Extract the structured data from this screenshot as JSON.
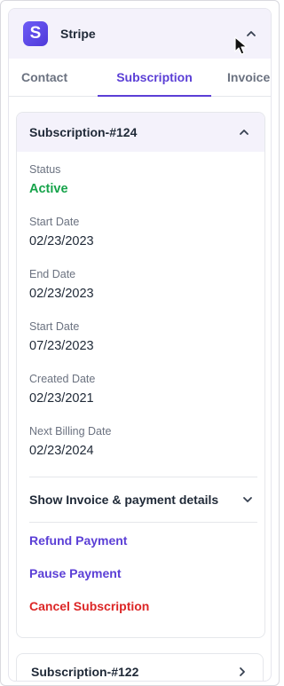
{
  "app": {
    "name": "Stripe",
    "logo_letter": "S"
  },
  "tabs": [
    {
      "label": "Contact"
    },
    {
      "label": "Subscription",
      "active": true
    },
    {
      "label": "Invoice"
    }
  ],
  "subscription": {
    "title": "Subscription-#124",
    "fields": [
      {
        "label": "Status",
        "value": "Active"
      },
      {
        "label": "Start Date",
        "value": "02/23/2023"
      },
      {
        "label": "End Date",
        "value": "02/23/2023"
      },
      {
        "label": "Start Date",
        "value": "07/23/2023"
      },
      {
        "label": "Created Date",
        "value": "02/23/2021"
      },
      {
        "label": "Next Billing Date",
        "value": "02/23/2024"
      }
    ],
    "details_label": "Show Invoice & payment details",
    "actions": [
      {
        "label": "Refund Payment"
      },
      {
        "label": "Pause Payment"
      },
      {
        "label": "Cancel Subscription"
      }
    ]
  },
  "other_subscription": {
    "title": "Subscription-#122"
  },
  "colors": {
    "accent": "#5b3fd6",
    "status_active": "#16a34a",
    "danger": "#dc2626",
    "header_bg": "#f4f2fb"
  }
}
